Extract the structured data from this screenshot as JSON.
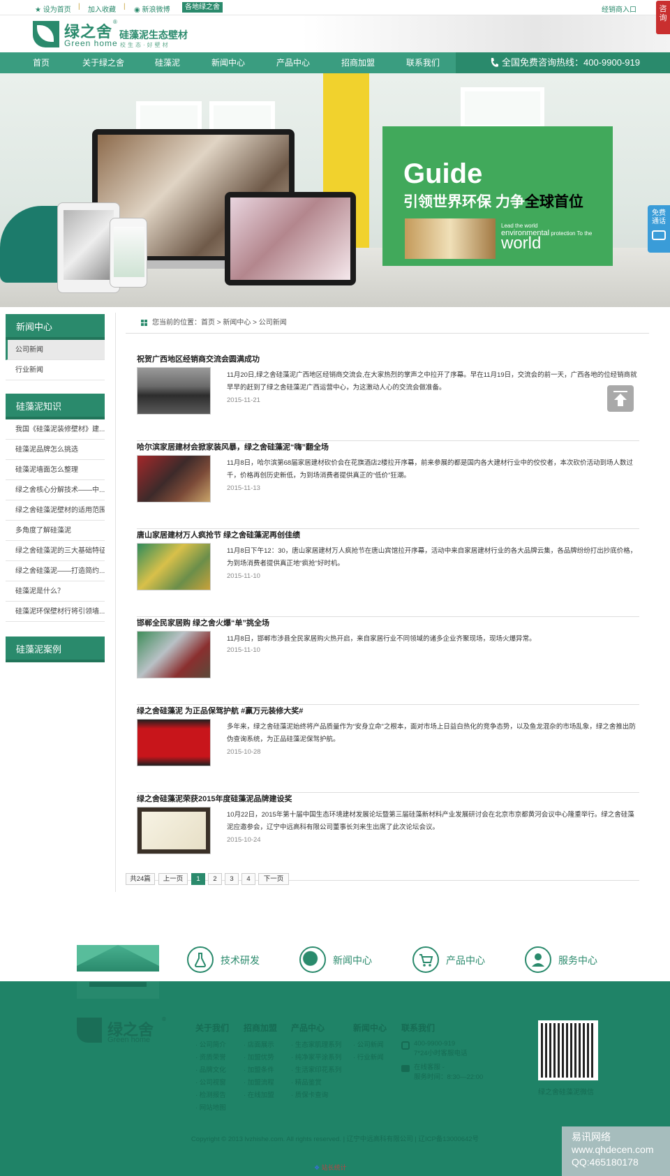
{
  "topbar": {
    "home": "设为首页",
    "fav": "加入收藏",
    "weibo": "新浪微博",
    "area": "各地绿之舍",
    "dealer": "经销商入口",
    "sep": "|"
  },
  "header": {
    "logo_cn": "绿之舍",
    "logo_reg": "®",
    "logo_en": "Green home",
    "slogan": "硅藻泥生态壁材",
    "sub": "校生态·好壁材",
    "consult": "咨询"
  },
  "nav": {
    "items": [
      "首页",
      "关于绿之舍",
      "硅藻泥",
      "新闻中心",
      "产品中心",
      "招商加盟",
      "联系我们"
    ],
    "hotline": "全国免费咨询热线：400-9900-919"
  },
  "banner": {
    "guide": "Guide",
    "line_a": "引领世界环保  力争",
    "line_b": "全球首位",
    "small1": "Lead the world",
    "small2": "environmental",
    "small3": "protection",
    "small4": "To the",
    "world": "world"
  },
  "sidecall": {
    "label": "免费通话"
  },
  "sidebar": {
    "news_head": "新闻中心",
    "news": [
      "公司新闻",
      "行业新闻"
    ],
    "know_head": "硅藻泥知识",
    "know": [
      "我国《硅藻泥装修壁材》建...",
      "硅藻泥品牌怎么挑选",
      "硅藻泥墙面怎么整理",
      "绿之舍核心分解技术——中...",
      "绿之舍硅藻泥壁材的适用范围",
      "多角度了解硅藻泥",
      "绿之舍硅藻泥的三大基础特征",
      "绿之舍硅藻泥——打造简约...",
      "硅藻泥是什么？",
      "硅藻泥环保壁材行将引领墙..."
    ],
    "case_head": "硅藻泥案例"
  },
  "breadcrumb": {
    "text": "您当前的位置：首页 > 新闻中心 > 公司新闻"
  },
  "news": [
    {
      "title": "祝贺广西地区经销商交流会圆满成功",
      "desc": "11月20日,绿之舍硅藻泥广西地区经销商交流会,在大家热烈的掌声之中拉开了序幕。早在11月19日，交流会的前一天，广西各地的位经销商就早早的赶到了绿之舍硅藻泥广西运营中心，为这激动人心的交流会做准备。",
      "date": "2015-11-21"
    },
    {
      "title": "哈尔滨家居建材会掀家装风暴，绿之舍硅藻泥“嗨”翻全场",
      "desc": "11月8日，哈尔滨第68届家居建材砍价会在花旗酒店2楼拉开序幕，前来参展的都是国内各大建材行业中的佼佼者，本次砍价活动到场人数过千，价格再创历史新低，为到场消费者提供真正的“低价”狂潮。",
      "date": "2015-11-13"
    },
    {
      "title": "唐山家居建材万人疯抢节 绿之舍硅藻泥再创佳绩",
      "desc": "11月8日下午12：30，唐山家居建材万人疯抢节在唐山宾馆拉开序幕，活动中来自家居建材行业的各大品牌云集，各品牌纷纷打出抄底价格，为到场消费者提供真正地“疯抢”好时机。",
      "date": "2015-11-10"
    },
    {
      "title": "邯郸全民家居购 绿之舍火爆“单”挑全场",
      "desc": "11月8日，邯郸市涉县全民家居购火热开启，来自家居行业不同领域的诸多企业齐聚现场，现场火爆异常。",
      "date": "2015-11-10"
    },
    {
      "title": "绿之舍硅藻泥 为正品保驾护航 #赢万元装修大奖#",
      "desc": "多年来，绿之舍硅藻泥始终将产品质量作为“安身立命”之根本，面对市场上日益白热化的竞争态势，以及鱼龙混杂的市场乱象，绿之舍推出防伪查询系统，为正品硅藻泥保驾护航。",
      "date": "2015-10-28"
    },
    {
      "title": "绿之舍硅藻泥荣获2015年度硅藻泥品牌建设奖",
      "desc": "10月22日，2015年第十届中国生态环境建材发展论坛暨第三届硅藻新材料产业发展研讨会在北京市京都黄河会议中心隆重举行。绿之舍硅藻泥应邀参会，辽宁中远高科有限公司董事长刘来生出席了此次论坛会议。",
      "date": "2015-10-24"
    }
  ],
  "pager": {
    "total": "共24篇",
    "prev": "上一页",
    "pages": [
      "1",
      "2",
      "3",
      "4"
    ],
    "next": "下一页"
  },
  "quick": [
    "技术研发",
    "新闻中心",
    "产品中心",
    "服务中心"
  ],
  "footer": {
    "logo_cn": "绿之舍",
    "logo_reg": "®",
    "logo_en": "Green home",
    "cols": [
      {
        "h": "关于我们",
        "links": [
          "· 公司简介",
          "· 资质荣誉",
          "· 品牌文化",
          "· 公司视窗",
          "· 检测报告",
          "· 网站地图"
        ]
      },
      {
        "h": "招商加盟",
        "links": [
          "· 店面展示",
          "· 加盟优势",
          "· 加盟条件",
          "· 加盟流程",
          "· 在线加盟"
        ]
      },
      {
        "h": "产品中心",
        "links": [
          "· 生态家肌理系列",
          "· 纯净家平涂系列",
          "· 生活家印花系列",
          "· 精品鉴赏",
          "· 质保卡查询"
        ]
      },
      {
        "h": "新闻中心",
        "links": [
          "· 公司新闻",
          "· 行业新闻"
        ]
      },
      {
        "h": "联系我们",
        "links": [
          "400-9900-919",
          "7*24小时客服电话",
          "在线客服 -",
          "服务时间：8:30—22:00"
        ]
      }
    ],
    "qr_label": "绿之舍硅藻泥微信",
    "copyright": "Copyright © 2013 lvzhishe.com. All rights reserved. | 辽宁中远高科有限公司 | 辽ICP备13000642号",
    "stat": "站长统计"
  },
  "watermark": [
    "易讯网络",
    "www.qhdecen.com",
    "QQ:465180178"
  ]
}
